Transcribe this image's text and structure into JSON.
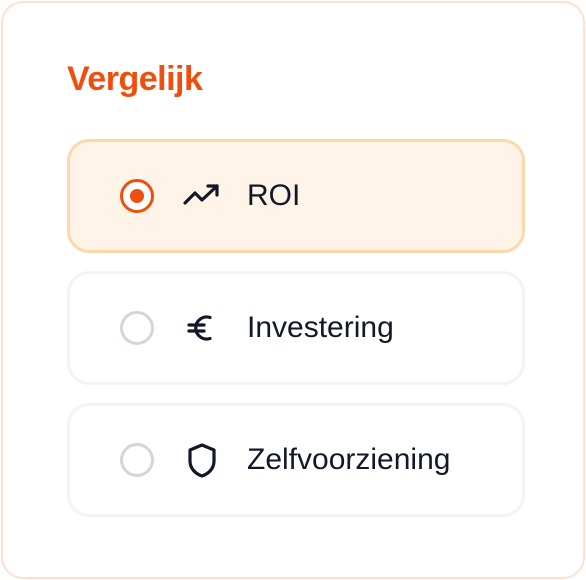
{
  "panel": {
    "title": "Vergelijk"
  },
  "options": [
    {
      "label": "ROI",
      "icon": "trending-up-icon",
      "selected": true
    },
    {
      "label": "Investering",
      "icon": "euro-icon",
      "selected": false
    },
    {
      "label": "Zelfvoorziening",
      "icon": "shield-icon",
      "selected": false
    }
  ],
  "colors": {
    "accent": "#f04e0c",
    "selected_bg": "#fff4e7",
    "selected_border": "#fbd9a8",
    "option_border": "#f1f3f5",
    "card_border": "#fde1d0",
    "text": "#111827",
    "radio_inactive": "#d2d6db"
  }
}
